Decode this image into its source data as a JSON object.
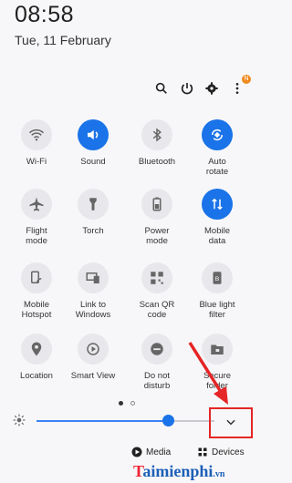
{
  "status": {
    "time": "08:58",
    "date": "Tue, 11 February"
  },
  "toolbar": {
    "notification_badge": "N"
  },
  "tiles": [
    {
      "label": "Wi-Fi",
      "icon": "wifi-icon",
      "on": false
    },
    {
      "label": "Sound",
      "icon": "sound-icon",
      "on": true
    },
    {
      "label": "Bluetooth",
      "icon": "bluetooth-icon",
      "on": false
    },
    {
      "label": "Auto\nrotate",
      "icon": "auto-rotate-icon",
      "on": true
    },
    {
      "label": "Flight\nmode",
      "icon": "airplane-icon",
      "on": false
    },
    {
      "label": "Torch",
      "icon": "torch-icon",
      "on": false
    },
    {
      "label": "Power\nmode",
      "icon": "battery-icon",
      "on": false
    },
    {
      "label": "Mobile\ndata",
      "icon": "mobile-data-icon",
      "on": true
    },
    {
      "label": "Mobile\nHotspot",
      "icon": "hotspot-icon",
      "on": false
    },
    {
      "label": "Link to\nWindows",
      "icon": "link-windows-icon",
      "on": false
    },
    {
      "label": "Scan QR\ncode",
      "icon": "qr-icon",
      "on": false
    },
    {
      "label": "Blue light\nfilter",
      "icon": "blue-light-icon",
      "on": false
    },
    {
      "label": "Location",
      "icon": "location-icon",
      "on": false
    },
    {
      "label": "Smart View",
      "icon": "smart-view-icon",
      "on": false
    },
    {
      "label": "Do not\ndisturb",
      "icon": "do-not-disturb-icon",
      "on": false
    },
    {
      "label": "Secure\nfolder",
      "icon": "secure-folder-icon",
      "on": false
    }
  ],
  "brightness": {
    "level": 0.75
  },
  "bottom": {
    "media_label": "Media",
    "devices_label": "Devices"
  },
  "watermark": {
    "text_a": "T",
    "text_b": "aimienphi",
    "text_c": ".vn"
  },
  "colors": {
    "accent": "#1a73e8",
    "highlight": "#e52526"
  }
}
